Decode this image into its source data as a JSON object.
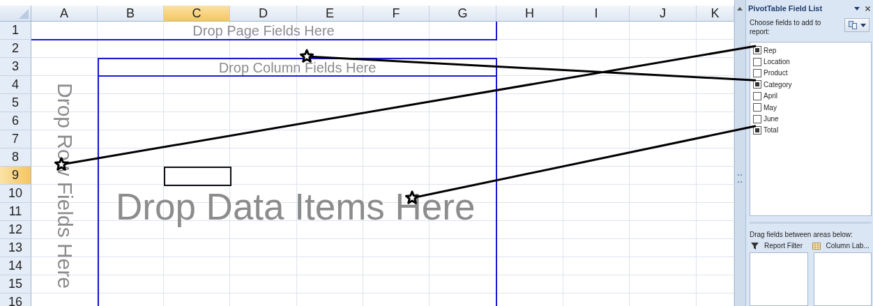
{
  "sheet": {
    "columns": [
      {
        "label": "A",
        "selected": false
      },
      {
        "label": "B",
        "selected": false
      },
      {
        "label": "C",
        "selected": true
      },
      {
        "label": "D",
        "selected": false
      },
      {
        "label": "E",
        "selected": false
      },
      {
        "label": "F",
        "selected": false
      },
      {
        "label": "G",
        "selected": false
      },
      {
        "label": "H",
        "selected": false
      },
      {
        "label": "I",
        "selected": false
      },
      {
        "label": "J",
        "selected": false
      },
      {
        "label": "K",
        "selected": false
      }
    ],
    "rows": [
      {
        "label": "1",
        "selected": false
      },
      {
        "label": "2",
        "selected": false
      },
      {
        "label": "3",
        "selected": false
      },
      {
        "label": "4",
        "selected": false
      },
      {
        "label": "5",
        "selected": false
      },
      {
        "label": "6",
        "selected": false
      },
      {
        "label": "7",
        "selected": false
      },
      {
        "label": "8",
        "selected": false
      },
      {
        "label": "9",
        "selected": true
      },
      {
        "label": "10",
        "selected": false
      },
      {
        "label": "11",
        "selected": false
      },
      {
        "label": "12",
        "selected": false
      },
      {
        "label": "13",
        "selected": false
      },
      {
        "label": "14",
        "selected": false
      },
      {
        "label": "15",
        "selected": false
      },
      {
        "label": "16",
        "selected": false
      }
    ]
  },
  "pivot_areas": [
    {
      "kind": "page",
      "text": "Drop Page Fields Here"
    },
    {
      "kind": "column",
      "text": "Drop Column Fields Here"
    },
    {
      "kind": "row",
      "text": "Drop Row Fields Here"
    },
    {
      "kind": "data",
      "text": "Drop Data Items Here"
    }
  ],
  "field_list": {
    "title": "PivotTable Field List",
    "prompt": "Choose fields to add to report:",
    "fields": [
      {
        "name": "Rep",
        "checked": true,
        "pointer": true
      },
      {
        "name": "Location",
        "checked": false
      },
      {
        "name": "Product",
        "checked": false
      },
      {
        "name": "Category",
        "checked": true,
        "pointer": true
      },
      {
        "name": "April",
        "checked": false
      },
      {
        "name": "May",
        "checked": false
      },
      {
        "name": "June",
        "checked": false
      },
      {
        "name": "Total",
        "checked": true,
        "pointer": true
      }
    ],
    "areas_prompt": "Drag fields between areas below:",
    "areas": [
      {
        "kind": "filter",
        "label": "Report Filter"
      },
      {
        "kind": "columns",
        "label": "Column Lab..."
      }
    ]
  }
}
